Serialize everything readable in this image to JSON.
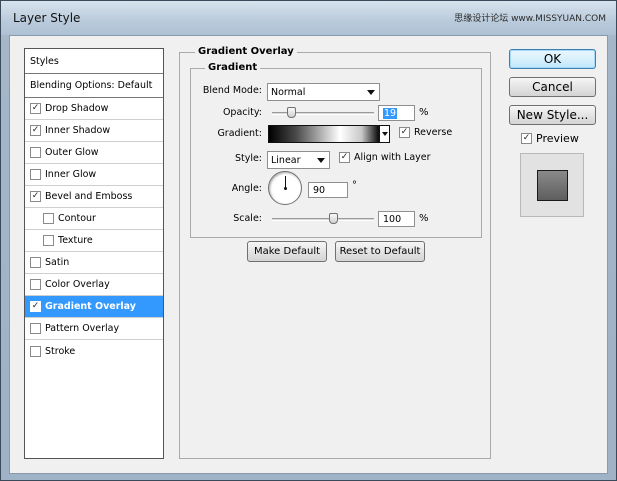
{
  "window": {
    "title": "Layer Style",
    "watermark": "思缘设计论坛  www.MISSYUAN.COM"
  },
  "styles_list": {
    "header": "Styles",
    "blending_options": "Blending Options: Default",
    "items": [
      {
        "label": "Drop Shadow",
        "checked": true
      },
      {
        "label": "Inner Shadow",
        "checked": true
      },
      {
        "label": "Outer Glow",
        "checked": false
      },
      {
        "label": "Inner Glow",
        "checked": false
      },
      {
        "label": "Bevel and Emboss",
        "checked": true
      },
      {
        "label": "Contour",
        "checked": false
      },
      {
        "label": "Texture",
        "checked": false
      },
      {
        "label": "Satin",
        "checked": false
      },
      {
        "label": "Color Overlay",
        "checked": false
      },
      {
        "label": "Gradient Overlay",
        "checked": true
      },
      {
        "label": "Pattern Overlay",
        "checked": false
      },
      {
        "label": "Stroke",
        "checked": false
      }
    ]
  },
  "gradient_overlay": {
    "group_title": "Gradient Overlay",
    "subgroup_title": "Gradient",
    "blend_mode_label": "Blend Mode:",
    "blend_mode_value": "Normal",
    "opacity_label": "Opacity:",
    "opacity_value": "19",
    "opacity_fraction": 0.19,
    "percent": "%",
    "gradient_label": "Gradient:",
    "reverse_label": "Reverse",
    "reverse_checked": true,
    "style_label": "Style:",
    "style_value": "Linear",
    "align_label": "Align with Layer",
    "align_checked": true,
    "angle_label": "Angle:",
    "angle_value": "90",
    "degree": "°",
    "scale_label": "Scale:",
    "scale_value": "100",
    "scale_fraction": 0.4,
    "make_default": "Make Default",
    "reset_default": "Reset to Default"
  },
  "actions": {
    "ok": "OK",
    "cancel": "Cancel",
    "new_style": "New Style...",
    "preview_label": "Preview",
    "preview_checked": true
  },
  "colors": {
    "selection": "#3399ff"
  }
}
